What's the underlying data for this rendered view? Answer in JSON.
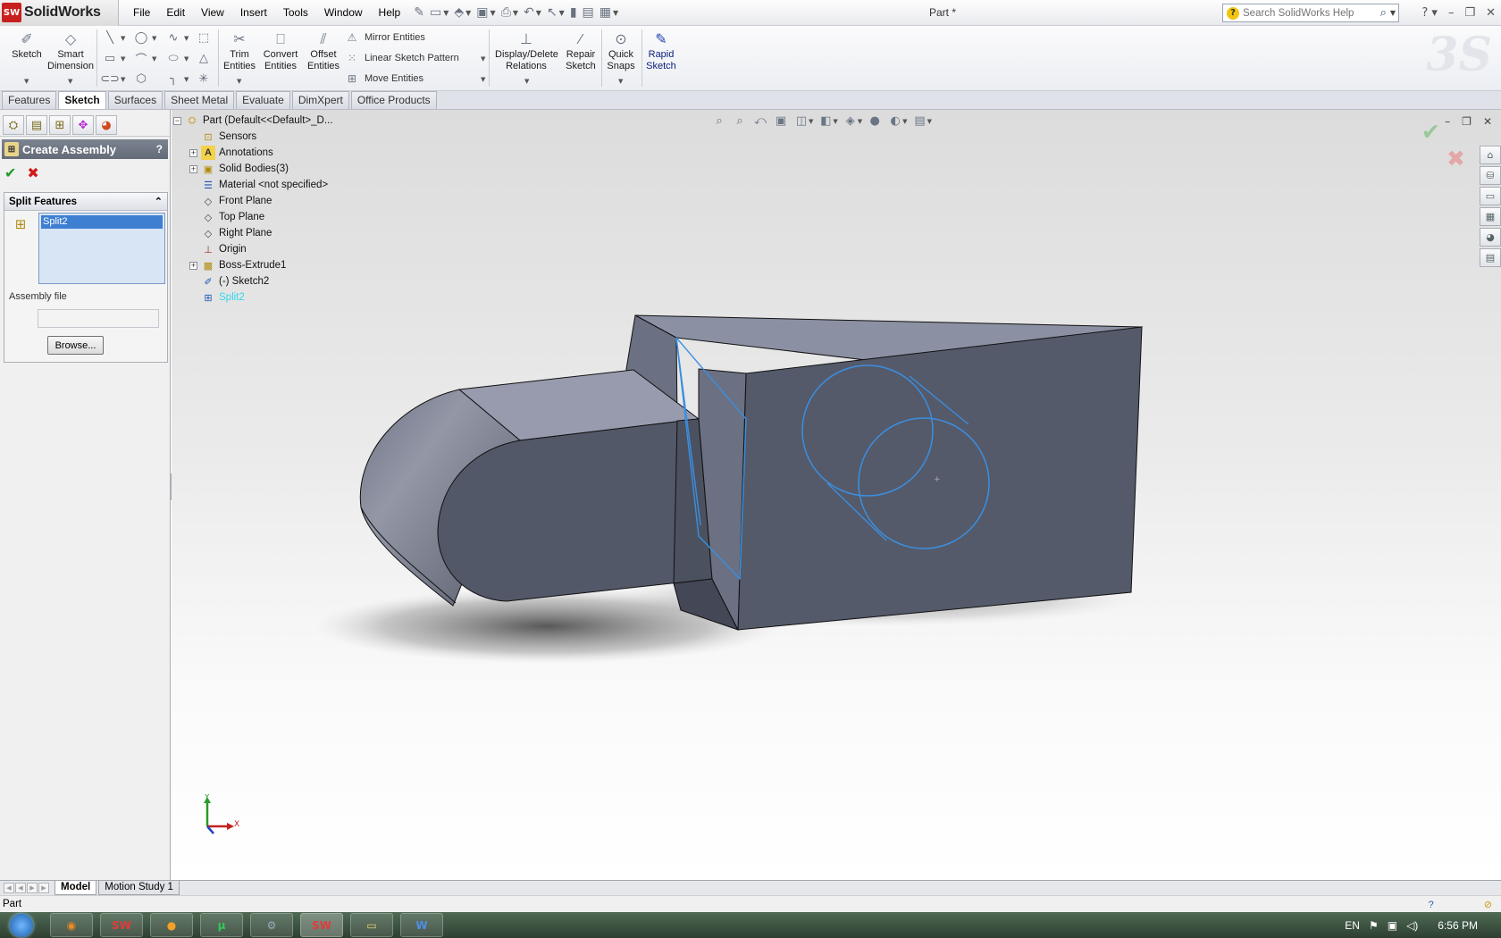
{
  "app": {
    "name": "SolidWorks",
    "badge": "SW",
    "document_title": "Part *"
  },
  "menu": [
    "File",
    "Edit",
    "View",
    "Insert",
    "Tools",
    "Window",
    "Help"
  ],
  "search": {
    "placeholder": "Search SolidWorks Help"
  },
  "command_manager": {
    "sketch": "Sketch",
    "smart_dimension": "Smart Dimension",
    "trim_entities": "Trim Entities",
    "convert_entities": "Convert Entities",
    "offset_entities": "Offset Entities",
    "mirror_entities": "Mirror Entities",
    "linear_sketch_pattern": "Linear Sketch Pattern",
    "move_entities": "Move Entities",
    "display_delete_relations": "Display/Delete Relations",
    "repair_sketch": "Repair Sketch",
    "quick_snaps": "Quick Snaps",
    "rapid_sketch": "Rapid Sketch"
  },
  "tabs": [
    {
      "label": "Features",
      "active": false
    },
    {
      "label": "Sketch",
      "active": true
    },
    {
      "label": "Surfaces",
      "active": false
    },
    {
      "label": "Sheet Metal",
      "active": false
    },
    {
      "label": "Evaluate",
      "active": false
    },
    {
      "label": "DimXpert",
      "active": false
    },
    {
      "label": "Office Products",
      "active": false
    }
  ],
  "property_manager": {
    "title": "Create Assembly",
    "help": "?",
    "ok": "✔",
    "cancel": "✖",
    "group_title": "Split Features",
    "selection": "Split2",
    "assembly_file_label": "Assembly file",
    "assembly_file_value": "",
    "browse_label": "Browse..."
  },
  "tree": [
    {
      "label": "Part  (Default<<Default>_D...",
      "icon": "part-icon",
      "expander": "−",
      "indent": 0
    },
    {
      "label": "Sensors",
      "icon": "sensors-icon",
      "expander": "",
      "indent": 1
    },
    {
      "label": "Annotations",
      "icon": "annotations-icon",
      "expander": "+",
      "indent": 1
    },
    {
      "label": "Solid Bodies(3)",
      "icon": "solid-bodies-icon",
      "expander": "+",
      "indent": 1
    },
    {
      "label": "Material <not specified>",
      "icon": "material-icon",
      "expander": "",
      "indent": 1
    },
    {
      "label": "Front Plane",
      "icon": "plane-icon",
      "expander": "",
      "indent": 1
    },
    {
      "label": "Top Plane",
      "icon": "plane-icon",
      "expander": "",
      "indent": 1
    },
    {
      "label": "Right Plane",
      "icon": "plane-icon",
      "expander": "",
      "indent": 1
    },
    {
      "label": "Origin",
      "icon": "origin-icon",
      "expander": "",
      "indent": 1
    },
    {
      "label": "Boss-Extrude1",
      "icon": "extrude-icon",
      "expander": "+",
      "indent": 1
    },
    {
      "label": "(-) Sketch2",
      "icon": "sketch-icon",
      "expander": "",
      "indent": 1
    },
    {
      "label": "Split2",
      "icon": "split-icon",
      "expander": "",
      "indent": 1
    }
  ],
  "triad": {
    "x": "X",
    "y": "Y"
  },
  "bottom_tabs": [
    {
      "label": "Model",
      "active": true
    },
    {
      "label": "Motion Study 1",
      "active": false
    }
  ],
  "status": {
    "text": "Part"
  },
  "taskbar": {
    "language": "EN",
    "time": "6:56 PM"
  },
  "colors": {
    "model_face": "#5a5f6f",
    "model_top": "#8c91a4",
    "sketch": "#3b8fe0",
    "tree_selected": "#2fd8ea"
  }
}
